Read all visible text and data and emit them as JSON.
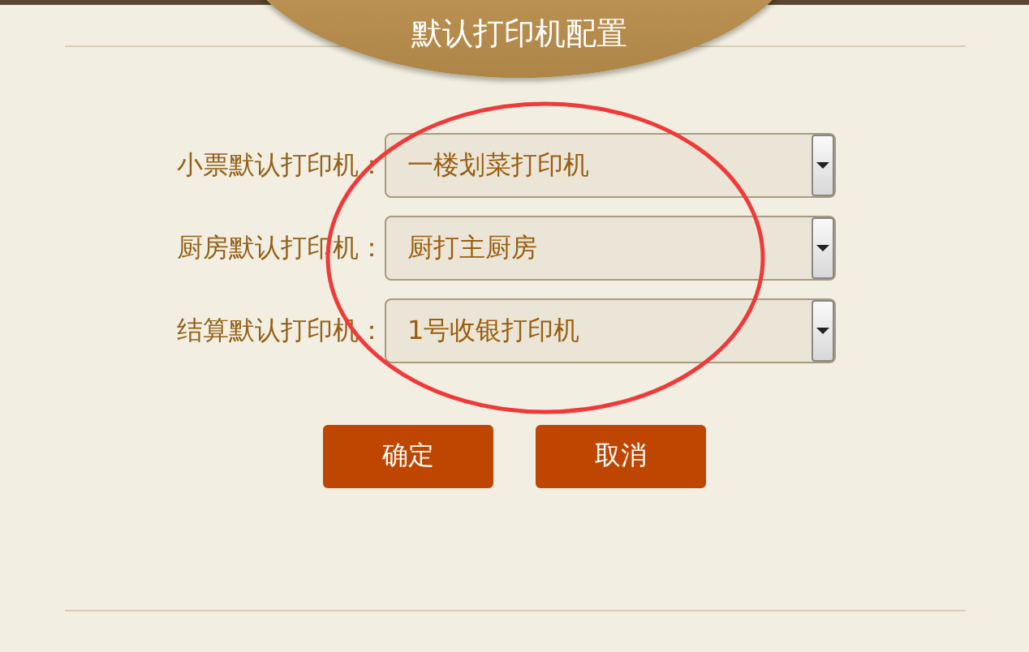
{
  "dialog": {
    "title": "默认打印机配置"
  },
  "fields": [
    {
      "label": "小票默认打印机：",
      "value": "一楼划菜打印机"
    },
    {
      "label": "厨房默认打印机：",
      "value": "厨打主厨房"
    },
    {
      "label": "结算默认打印机：",
      "value": "1号收银打印机"
    }
  ],
  "buttons": [
    "确定",
    "取消"
  ]
}
